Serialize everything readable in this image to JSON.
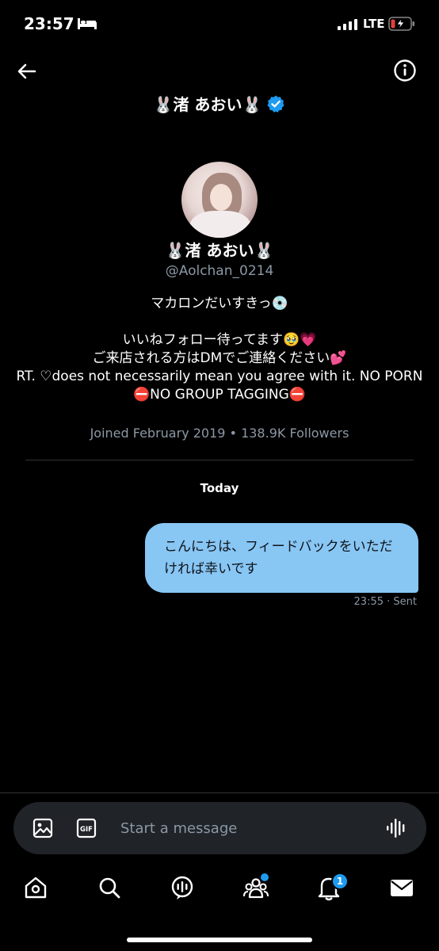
{
  "status_bar": {
    "time": "23:57",
    "network": "LTE"
  },
  "header": {
    "title": "🐰渚 あおい🐰"
  },
  "profile": {
    "name": "🐰渚 あおい🐰",
    "handle": "@Aolchan_0214",
    "bio": "マカロンだいすきっ💿\n\nいいねフォロー待ってます🥹💗\nご来店される方はDMでご連絡ください💕\nRT. ♡does not necessarily mean you agree with it.  NO PORN⛔NO GROUP TAGGING⛔",
    "meta": "Joined February 2019 • 138.9K Followers"
  },
  "conversation": {
    "date_label": "Today",
    "messages": [
      {
        "text": "こんにちは、フィードバックをいただければ幸いです",
        "time": "23:55",
        "status": "· Sent"
      }
    ]
  },
  "composer": {
    "placeholder": "Start a message",
    "gif_label": "GIF"
  },
  "tab_bar": {
    "items": [
      "home-icon",
      "search-icon",
      "spaces-icon",
      "communities-icon",
      "notifications-icon",
      "messages-icon"
    ],
    "notification_badge": "1"
  },
  "colors": {
    "accent": "#1d9bf0",
    "bubble": "#88c6f4",
    "muted": "#8b98a5"
  }
}
